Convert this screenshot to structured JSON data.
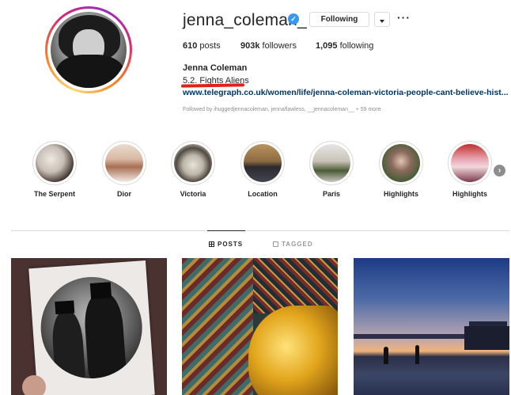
{
  "profile": {
    "username": "jenna_coleman_",
    "verified_mark": "✓",
    "following_button": "Following",
    "more_button": "···",
    "stats": {
      "posts_count": "610",
      "posts_label": "posts",
      "followers_count": "903k",
      "followers_label": "followers",
      "following_count": "1,095",
      "following_label": "following"
    },
    "full_name": "Jenna Coleman",
    "bio": "5.2. Fights Aliens",
    "link": "www.telegraph.co.uk/women/life/jenna-coleman-victoria-people-cant-believe-hist...",
    "followed_by": "Followed by ihuggedjennacoleman, jennaflawless, __jennacoleman__ + 59 more"
  },
  "highlights": {
    "items": [
      {
        "label": "The Serpent"
      },
      {
        "label": "Dior"
      },
      {
        "label": "Victoria"
      },
      {
        "label": "Location"
      },
      {
        "label": "Paris"
      },
      {
        "label": "Highlights"
      },
      {
        "label": "Highlights"
      }
    ],
    "next_arrow": "›"
  },
  "tabs": {
    "posts": "POSTS",
    "tagged": "TAGGED",
    "active": "POSTS"
  },
  "colors": {
    "verified": "#3897f0",
    "link": "#003569",
    "underline": "#e0211b",
    "muted": "#8e8e8e"
  },
  "icons": {
    "verified": "verified-badge-icon",
    "dropdown": "chevron-down-icon",
    "more": "ellipsis-icon",
    "posts_tab": "grid-icon",
    "tagged_tab": "tag-icon",
    "next": "chevron-right-icon"
  }
}
